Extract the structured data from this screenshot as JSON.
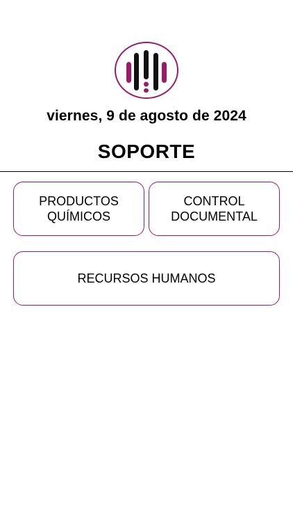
{
  "header": {
    "logo_icon": "brand-logo-icon",
    "date": "viernes, 9 de agosto de 2024",
    "title": "SOPORTE"
  },
  "menu": {
    "items": [
      {
        "label": "PRODUCTOS\nQUÍMICOS"
      },
      {
        "label": "CONTROL\nDOCUMENTAL"
      },
      {
        "label": "RECURSOS HUMANOS"
      }
    ]
  },
  "colors": {
    "accent": "#9b1b6a",
    "text": "#000000",
    "background": "#ffffff"
  }
}
